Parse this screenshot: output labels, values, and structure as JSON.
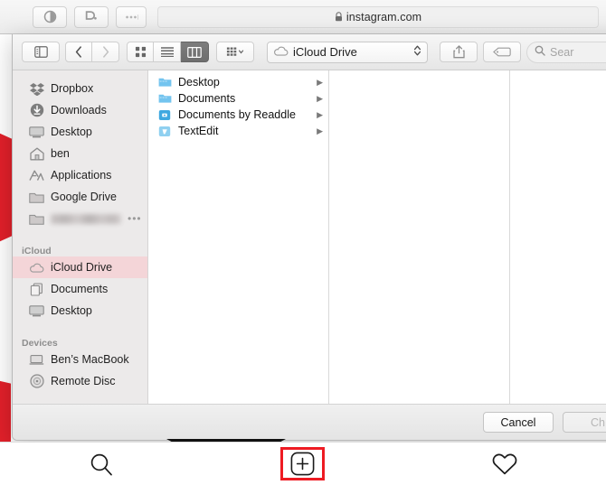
{
  "browser": {
    "buttons": [
      {
        "name": "reader-view-button",
        "icon": "reader-icon",
        "label": ""
      },
      {
        "name": "duckduckgo-button",
        "icon": "duckduckgo-icon",
        "label": ""
      },
      {
        "name": "more-extensions-button",
        "icon": "ellipsis-icon",
        "label": ""
      }
    ],
    "url": "instagram.com",
    "secure_icon": "lock-icon"
  },
  "dialog": {
    "toolbar": {
      "sidebar_toggle_icon": "sidebar-toggle-icon",
      "back_label": "‹",
      "forward_label": "›",
      "view_icon_label": "icon-view-icon",
      "view_list_label": "list-view-icon",
      "view_column_label": "column-view-icon",
      "arrange_label": "arrange-icon",
      "path_label": "iCloud Drive",
      "path_icon": "icloud-icon",
      "share_icon": "share-icon",
      "tag_icon": "tag-icon",
      "search_placeholder": "Sear"
    },
    "sidebar": {
      "favorites": [
        {
          "label": "Dropbox",
          "icon": "dropbox-icon"
        },
        {
          "label": "Downloads",
          "icon": "downloads-icon"
        },
        {
          "label": "Desktop",
          "icon": "desktop-icon"
        },
        {
          "label": "ben",
          "icon": "home-icon"
        },
        {
          "label": "Applications",
          "icon": "applications-icon"
        },
        {
          "label": "Google Drive",
          "icon": "folder-icon"
        },
        {
          "label": "",
          "icon": "folder-icon",
          "redacted": true,
          "ellipsis": "•••"
        }
      ],
      "icloud_header": "iCloud",
      "icloud": [
        {
          "label": "iCloud Drive",
          "icon": "icloud-icon",
          "selected": true
        },
        {
          "label": "Documents",
          "icon": "documents-icon"
        },
        {
          "label": "Desktop",
          "icon": "desktop-icon"
        }
      ],
      "devices_header": "Devices",
      "devices": [
        {
          "label": "Ben’s MacBook",
          "icon": "laptop-icon"
        },
        {
          "label": "Remote Disc",
          "icon": "disc-icon"
        }
      ]
    },
    "files": [
      {
        "name": "Desktop",
        "icon": "folder-blue-icon",
        "chevron": "▶"
      },
      {
        "name": "Documents",
        "icon": "folder-blue-icon",
        "chevron": "▶"
      },
      {
        "name": "Documents by Readdle",
        "icon": "app-folder-icon",
        "chevron": "▶"
      },
      {
        "name": "TextEdit",
        "icon": "app-folder-icon",
        "chevron": "▶"
      }
    ],
    "footer": {
      "cancel_label": "Cancel",
      "choose_label": "Ch"
    }
  },
  "tabbar": {
    "items": [
      {
        "name": "search-tab",
        "icon": "search-icon",
        "highlighted": false
      },
      {
        "name": "new-post-tab",
        "icon": "plus-square-icon",
        "highlighted": true
      },
      {
        "name": "activity-tab",
        "icon": "heart-icon",
        "highlighted": false
      }
    ]
  },
  "colors": {
    "accent_red": "#ee1b23",
    "selection_pink": "#f4d5d8",
    "folder_blue": "#6fc4ef"
  }
}
